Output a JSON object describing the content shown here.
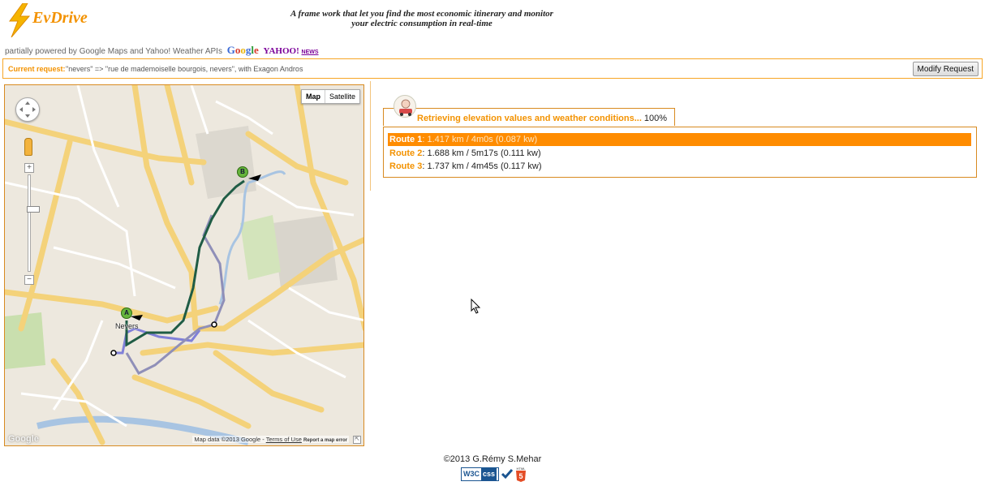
{
  "header": {
    "logo_text": "EvDrive",
    "tagline_line1": "A frame work that let you find the most economic itinerary  and monitor",
    "tagline_line2": "your electric consumption in real-time",
    "powered_by": "partially powered by Google Maps and Yahoo! Weather APIs",
    "google_logo": "Google",
    "yahoo_logo": "YAHOO!",
    "news_label": "NEWS"
  },
  "request": {
    "label": "Current request:",
    "text": "\"nevers\" => \"rue de mademoiselle bourgois, nevers\", with Exagon Andros",
    "modify_button": "Modify Request"
  },
  "map": {
    "type_map": "Map",
    "type_satellite": "Satellite",
    "marker_a": "A",
    "marker_b": "B",
    "city_label": "Nevers",
    "logo": "Google",
    "attribution": "Map data ©2013 Google -",
    "terms": "Terms of Use",
    "report": "Report a map error",
    "route_colors": {
      "route1": "#1f5c45",
      "route2": "#8080d8",
      "route3": "#8f8fb8"
    }
  },
  "status": {
    "message": "Retrieving elevation values and weather conditions...",
    "percent": "100%"
  },
  "routes": [
    {
      "name": "Route 1",
      "detail": ": 1.417 km / 4m0s (0.087 kw)",
      "selected": true
    },
    {
      "name": "Route 2",
      "detail": ": 1.688 km / 5m17s (0.111 kw)",
      "selected": false
    },
    {
      "name": "Route 3",
      "detail": ": 1.737 km / 4m45s (0.117 kw)",
      "selected": false
    }
  ],
  "footer": {
    "copyright": "©2013 G.Rémy S.Mehar",
    "w3c": "W3C",
    "css": "css",
    "html5": "HTML"
  },
  "colors": {
    "accent": "#f39200",
    "selected_route_bg": "#ff8c00"
  }
}
